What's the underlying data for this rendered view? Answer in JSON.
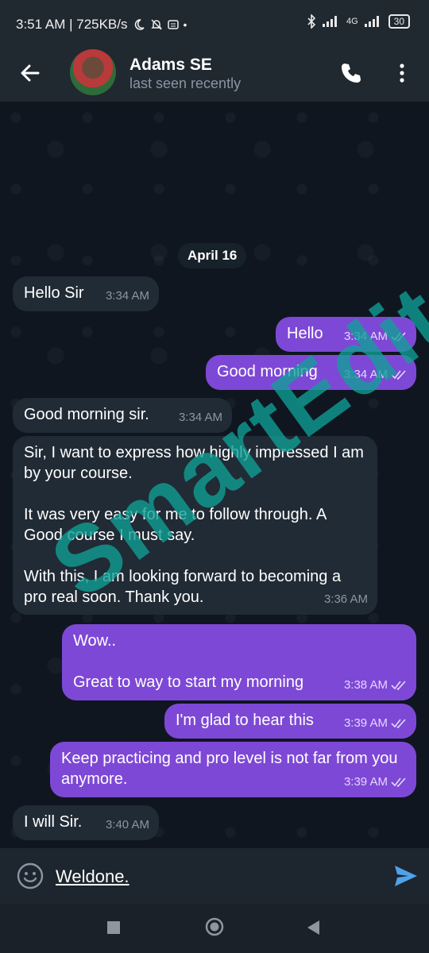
{
  "status_bar": {
    "time_speed": "3:51 AM | 725KB/s",
    "network": "4G",
    "battery": "30"
  },
  "header": {
    "name": "Adams SE",
    "status": "last seen recently"
  },
  "chat": {
    "date": "April 16",
    "messages": [
      {
        "dir": "in",
        "text": "Hello Sir",
        "time": "3:34 AM"
      },
      {
        "dir": "out",
        "text": "Hello",
        "time": "3:34 AM"
      },
      {
        "dir": "out",
        "text": "Good morning",
        "time": "3:34 AM"
      },
      {
        "dir": "in",
        "text": "Good morning sir.",
        "time": "3:34 AM"
      },
      {
        "dir": "in",
        "text": "Sir, I want to express how highly impressed I am by your course.\n\nIt was very easy for me to follow through. A Good course I must say.\n\nWith this, I am looking forward to becoming a pro real soon. Thank you.",
        "time": "3:36 AM"
      },
      {
        "dir": "out",
        "text": "Wow..\n\nGreat to way to start my morning",
        "time": "3:38 AM"
      },
      {
        "dir": "out",
        "text": "I'm glad to hear this",
        "time": "3:39 AM"
      },
      {
        "dir": "out",
        "text": "Keep practicing and pro level is not far from you anymore.",
        "time": "3:39 AM"
      },
      {
        "dir": "in",
        "text": "I will Sir.",
        "time": "3:40 AM"
      }
    ]
  },
  "watermark": "SmartEdit",
  "composer": {
    "value": "Weldone."
  },
  "colors": {
    "outgoing": "#7e48d6",
    "incoming": "#212b35",
    "accent": "#4fa3e8"
  }
}
